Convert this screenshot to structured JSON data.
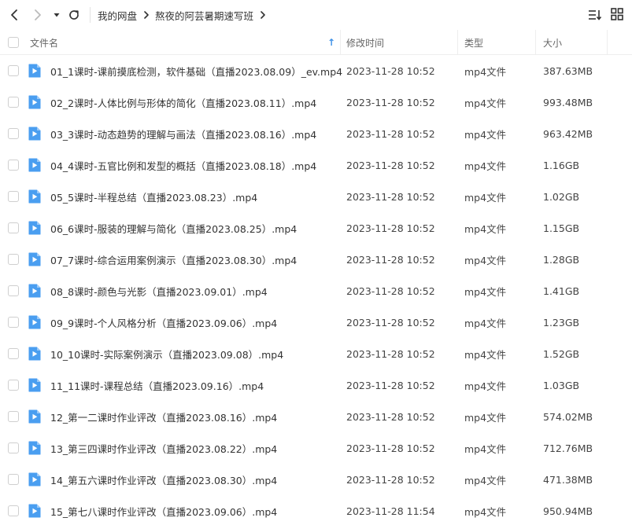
{
  "colors": {
    "accent": "#3b8fe6",
    "file_icon": "#4a9ef0"
  },
  "toolbar": {
    "back_icon": "chevron-left-icon",
    "forward_icon": "chevron-right-icon",
    "history_icon": "caret-down-icon",
    "refresh_icon": "refresh-icon",
    "breadcrumb": [
      "我的网盘",
      "熬夜的阿芸暑期速写班"
    ],
    "sort_icon": "sort-list-icon",
    "grid_icon": "grid-view-icon"
  },
  "header": {
    "name": "文件名",
    "sort_indicator": "↑",
    "modified": "修改时间",
    "type": "类型",
    "size": "大小"
  },
  "files": [
    {
      "name": "01_1课时-课前摸底检测，软件基础（直播2023.08.09）_ev.mp4",
      "modified": "2023-11-28 10:52",
      "type": "mp4文件",
      "size": "387.63MB"
    },
    {
      "name": "02_2课时-人体比例与形体的简化（直播2023.08.11）.mp4",
      "modified": "2023-11-28 10:52",
      "type": "mp4文件",
      "size": "993.48MB"
    },
    {
      "name": "03_3课时-动态趋势的理解与画法（直播2023.08.16）.mp4",
      "modified": "2023-11-28 10:52",
      "type": "mp4文件",
      "size": "963.42MB"
    },
    {
      "name": "04_4课时-五官比例和发型的概括（直播2023.08.18）.mp4",
      "modified": "2023-11-28 10:52",
      "type": "mp4文件",
      "size": "1.16GB"
    },
    {
      "name": "05_5课时-半程总结（直播2023.08.23）.mp4",
      "modified": "2023-11-28 10:52",
      "type": "mp4文件",
      "size": "1.02GB"
    },
    {
      "name": "06_6课时-服装的理解与简化（直播2023.08.25）.mp4",
      "modified": "2023-11-28 10:52",
      "type": "mp4文件",
      "size": "1.15GB"
    },
    {
      "name": "07_7课时-综合运用案例演示（直播2023.08.30）.mp4",
      "modified": "2023-11-28 10:52",
      "type": "mp4文件",
      "size": "1.28GB"
    },
    {
      "name": "08_8课时-颜色与光影（直播2023.09.01）.mp4",
      "modified": "2023-11-28 10:52",
      "type": "mp4文件",
      "size": "1.41GB"
    },
    {
      "name": "09_9课时-个人风格分析（直播2023.09.06）.mp4",
      "modified": "2023-11-28 10:52",
      "type": "mp4文件",
      "size": "1.23GB"
    },
    {
      "name": "10_10课时-实际案例演示（直播2023.09.08）.mp4",
      "modified": "2023-11-28 10:52",
      "type": "mp4文件",
      "size": "1.52GB"
    },
    {
      "name": "11_11课时-课程总结（直播2023.09.16）.mp4",
      "modified": "2023-11-28 10:52",
      "type": "mp4文件",
      "size": "1.03GB"
    },
    {
      "name": "12_第一二课时作业评改（直播2023.08.16）.mp4",
      "modified": "2023-11-28 10:52",
      "type": "mp4文件",
      "size": "574.02MB"
    },
    {
      "name": "13_第三四课时作业评改（直播2023.08.22）.mp4",
      "modified": "2023-11-28 10:52",
      "type": "mp4文件",
      "size": "712.76MB"
    },
    {
      "name": "14_第五六课时作业评改（直播2023.08.30）.mp4",
      "modified": "2023-11-28 10:52",
      "type": "mp4文件",
      "size": "471.38MB"
    },
    {
      "name": "15_第七八课时作业评改（直播2023.09.06）.mp4",
      "modified": "2023-11-28 11:54",
      "type": "mp4文件",
      "size": "950.94MB"
    }
  ]
}
